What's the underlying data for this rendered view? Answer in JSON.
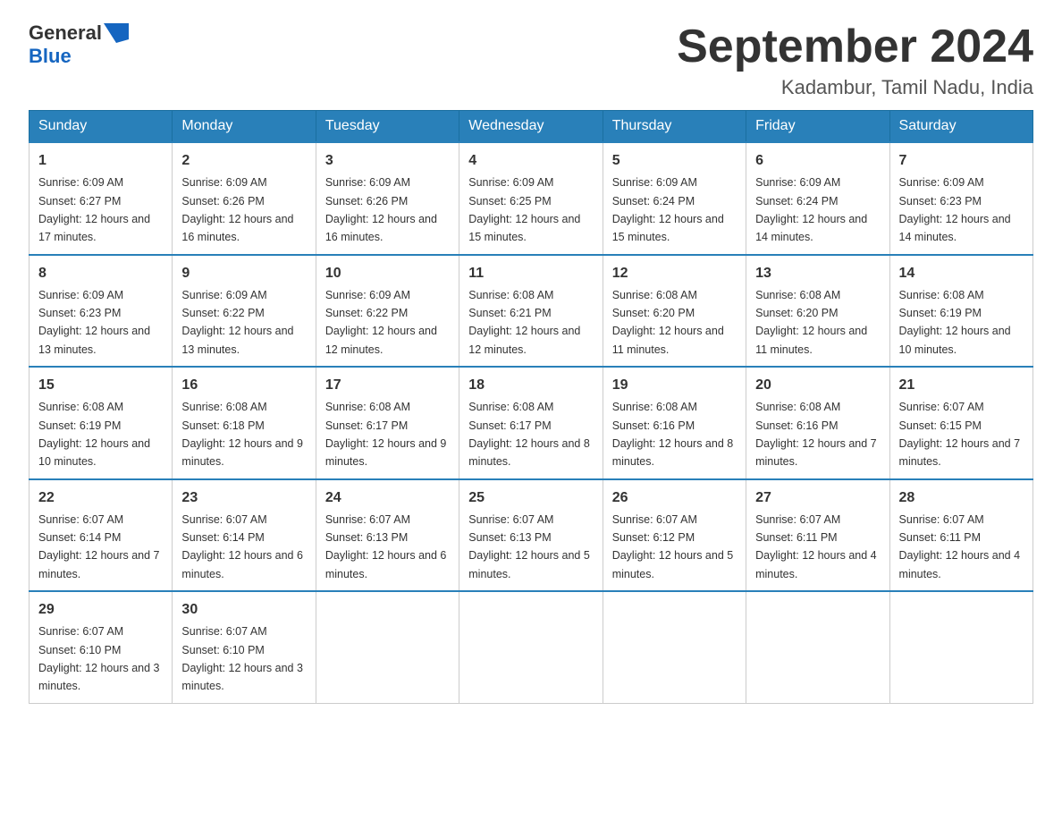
{
  "header": {
    "logo_general": "General",
    "logo_blue": "Blue",
    "title": "September 2024",
    "subtitle": "Kadambur, Tamil Nadu, India"
  },
  "days_of_week": [
    "Sunday",
    "Monday",
    "Tuesday",
    "Wednesday",
    "Thursday",
    "Friday",
    "Saturday"
  ],
  "weeks": [
    [
      {
        "day": "1",
        "sunrise": "Sunrise: 6:09 AM",
        "sunset": "Sunset: 6:27 PM",
        "daylight": "Daylight: 12 hours and 17 minutes."
      },
      {
        "day": "2",
        "sunrise": "Sunrise: 6:09 AM",
        "sunset": "Sunset: 6:26 PM",
        "daylight": "Daylight: 12 hours and 16 minutes."
      },
      {
        "day": "3",
        "sunrise": "Sunrise: 6:09 AM",
        "sunset": "Sunset: 6:26 PM",
        "daylight": "Daylight: 12 hours and 16 minutes."
      },
      {
        "day": "4",
        "sunrise": "Sunrise: 6:09 AM",
        "sunset": "Sunset: 6:25 PM",
        "daylight": "Daylight: 12 hours and 15 minutes."
      },
      {
        "day": "5",
        "sunrise": "Sunrise: 6:09 AM",
        "sunset": "Sunset: 6:24 PM",
        "daylight": "Daylight: 12 hours and 15 minutes."
      },
      {
        "day": "6",
        "sunrise": "Sunrise: 6:09 AM",
        "sunset": "Sunset: 6:24 PM",
        "daylight": "Daylight: 12 hours and 14 minutes."
      },
      {
        "day": "7",
        "sunrise": "Sunrise: 6:09 AM",
        "sunset": "Sunset: 6:23 PM",
        "daylight": "Daylight: 12 hours and 14 minutes."
      }
    ],
    [
      {
        "day": "8",
        "sunrise": "Sunrise: 6:09 AM",
        "sunset": "Sunset: 6:23 PM",
        "daylight": "Daylight: 12 hours and 13 minutes."
      },
      {
        "day": "9",
        "sunrise": "Sunrise: 6:09 AM",
        "sunset": "Sunset: 6:22 PM",
        "daylight": "Daylight: 12 hours and 13 minutes."
      },
      {
        "day": "10",
        "sunrise": "Sunrise: 6:09 AM",
        "sunset": "Sunset: 6:22 PM",
        "daylight": "Daylight: 12 hours and 12 minutes."
      },
      {
        "day": "11",
        "sunrise": "Sunrise: 6:08 AM",
        "sunset": "Sunset: 6:21 PM",
        "daylight": "Daylight: 12 hours and 12 minutes."
      },
      {
        "day": "12",
        "sunrise": "Sunrise: 6:08 AM",
        "sunset": "Sunset: 6:20 PM",
        "daylight": "Daylight: 12 hours and 11 minutes."
      },
      {
        "day": "13",
        "sunrise": "Sunrise: 6:08 AM",
        "sunset": "Sunset: 6:20 PM",
        "daylight": "Daylight: 12 hours and 11 minutes."
      },
      {
        "day": "14",
        "sunrise": "Sunrise: 6:08 AM",
        "sunset": "Sunset: 6:19 PM",
        "daylight": "Daylight: 12 hours and 10 minutes."
      }
    ],
    [
      {
        "day": "15",
        "sunrise": "Sunrise: 6:08 AM",
        "sunset": "Sunset: 6:19 PM",
        "daylight": "Daylight: 12 hours and 10 minutes."
      },
      {
        "day": "16",
        "sunrise": "Sunrise: 6:08 AM",
        "sunset": "Sunset: 6:18 PM",
        "daylight": "Daylight: 12 hours and 9 minutes."
      },
      {
        "day": "17",
        "sunrise": "Sunrise: 6:08 AM",
        "sunset": "Sunset: 6:17 PM",
        "daylight": "Daylight: 12 hours and 9 minutes."
      },
      {
        "day": "18",
        "sunrise": "Sunrise: 6:08 AM",
        "sunset": "Sunset: 6:17 PM",
        "daylight": "Daylight: 12 hours and 8 minutes."
      },
      {
        "day": "19",
        "sunrise": "Sunrise: 6:08 AM",
        "sunset": "Sunset: 6:16 PM",
        "daylight": "Daylight: 12 hours and 8 minutes."
      },
      {
        "day": "20",
        "sunrise": "Sunrise: 6:08 AM",
        "sunset": "Sunset: 6:16 PM",
        "daylight": "Daylight: 12 hours and 7 minutes."
      },
      {
        "day": "21",
        "sunrise": "Sunrise: 6:07 AM",
        "sunset": "Sunset: 6:15 PM",
        "daylight": "Daylight: 12 hours and 7 minutes."
      }
    ],
    [
      {
        "day": "22",
        "sunrise": "Sunrise: 6:07 AM",
        "sunset": "Sunset: 6:14 PM",
        "daylight": "Daylight: 12 hours and 7 minutes."
      },
      {
        "day": "23",
        "sunrise": "Sunrise: 6:07 AM",
        "sunset": "Sunset: 6:14 PM",
        "daylight": "Daylight: 12 hours and 6 minutes."
      },
      {
        "day": "24",
        "sunrise": "Sunrise: 6:07 AM",
        "sunset": "Sunset: 6:13 PM",
        "daylight": "Daylight: 12 hours and 6 minutes."
      },
      {
        "day": "25",
        "sunrise": "Sunrise: 6:07 AM",
        "sunset": "Sunset: 6:13 PM",
        "daylight": "Daylight: 12 hours and 5 minutes."
      },
      {
        "day": "26",
        "sunrise": "Sunrise: 6:07 AM",
        "sunset": "Sunset: 6:12 PM",
        "daylight": "Daylight: 12 hours and 5 minutes."
      },
      {
        "day": "27",
        "sunrise": "Sunrise: 6:07 AM",
        "sunset": "Sunset: 6:11 PM",
        "daylight": "Daylight: 12 hours and 4 minutes."
      },
      {
        "day": "28",
        "sunrise": "Sunrise: 6:07 AM",
        "sunset": "Sunset: 6:11 PM",
        "daylight": "Daylight: 12 hours and 4 minutes."
      }
    ],
    [
      {
        "day": "29",
        "sunrise": "Sunrise: 6:07 AM",
        "sunset": "Sunset: 6:10 PM",
        "daylight": "Daylight: 12 hours and 3 minutes."
      },
      {
        "day": "30",
        "sunrise": "Sunrise: 6:07 AM",
        "sunset": "Sunset: 6:10 PM",
        "daylight": "Daylight: 12 hours and 3 minutes."
      },
      null,
      null,
      null,
      null,
      null
    ]
  ]
}
